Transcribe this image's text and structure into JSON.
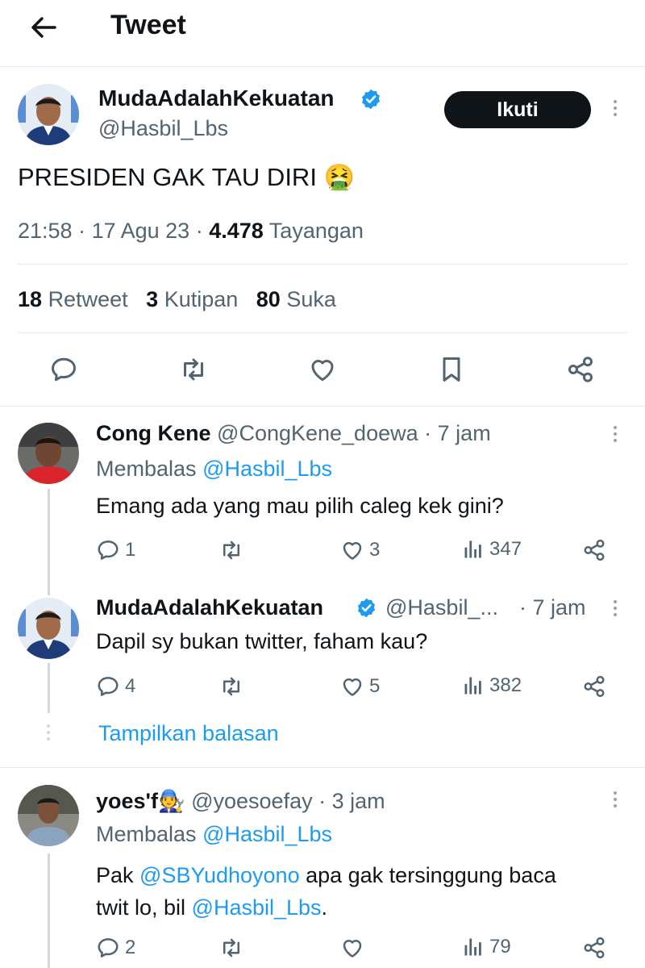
{
  "header": {
    "title": "Tweet"
  },
  "main_tweet": {
    "author_name": "MudaAdalahKekuatan",
    "handle": "@Hasbil_Lbs",
    "follow_label": "Ikuti",
    "text": "PRESIDEN GAK TAU DIRI 🤮",
    "time": "21:58",
    "date": "17 Agu 23",
    "views_count": "4.478",
    "views_label": "Tayangan",
    "retweets_count": "18",
    "retweets_label": "Retweet",
    "quotes_count": "3",
    "quotes_label": "Kutipan",
    "likes_count": "80",
    "likes_label": "Suka"
  },
  "replies": [
    {
      "name": "Cong Kene",
      "handle": "@CongKene_doewa",
      "time": "7 jam",
      "replying_label": "Membalas",
      "replying_to": "@Hasbil_Lbs",
      "text": "Emang ada yang mau pilih caleg kek gini?",
      "reply_count": "1",
      "like_count": "3",
      "view_count": "347"
    },
    {
      "name": "MudaAdalahKekuatan",
      "handle": "@Hasbil_...",
      "time": "7 jam",
      "text": "Dapil sy bukan twitter, faham kau?",
      "reply_count": "4",
      "like_count": "5",
      "view_count": "382"
    },
    {
      "name": "yoes'f🧑‍🔧",
      "handle": "@yoesoefay",
      "time": "3 jam",
      "replying_label": "Membalas",
      "replying_to": "@Hasbil_Lbs",
      "text_part1": "Pak ",
      "mention1": "@SBYudhoyono",
      "text_part2": " apa gak tersinggung baca",
      "text_part3": "twit lo, bil ",
      "mention2": "@Hasbil_Lbs",
      "text_part4": ".",
      "reply_count": "2",
      "view_count": "79"
    }
  ],
  "show_replies_label": "Tampilkan balasan",
  "colors": {
    "accent": "#1d9bf0",
    "text": "#0f1419",
    "muted": "#536471",
    "verified": "#1d9bf0",
    "button_bg": "#0f1419"
  },
  "icons": [
    "back-arrow-icon",
    "verified-badge-icon",
    "more-icon",
    "reply-icon",
    "retweet-icon",
    "like-icon",
    "bookmark-icon",
    "share-icon",
    "views-icon"
  ]
}
